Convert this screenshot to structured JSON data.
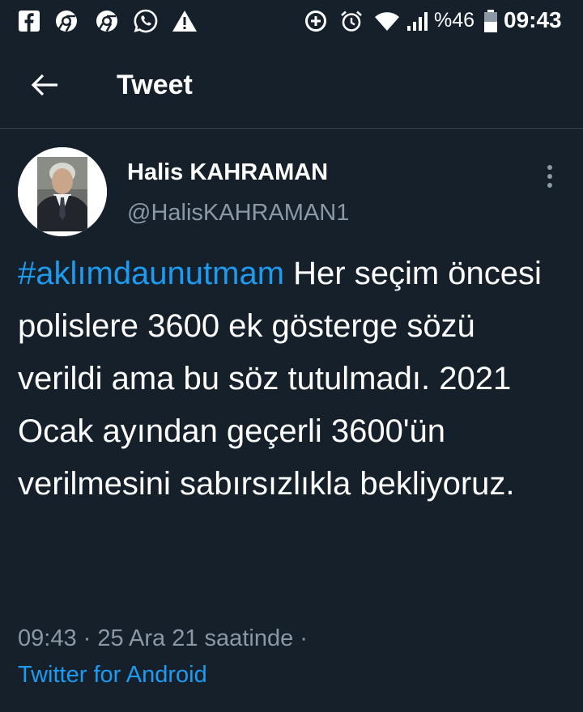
{
  "status_bar": {
    "left_icons": [
      "facebook-icon",
      "chrome-icon",
      "chrome-icon",
      "whatsapp-icon",
      "warning-icon"
    ],
    "right_icons": [
      "data-saver-icon",
      "alarm-icon",
      "wifi-icon",
      "signal-icon",
      "battery-icon"
    ],
    "battery_percent": "%46",
    "time": "09:43"
  },
  "header": {
    "title": "Tweet",
    "back_icon": "arrow-left-icon"
  },
  "tweet": {
    "author_name": "Halis KAHRAMAN",
    "author_handle": "@HalisKAHRAMAN1",
    "hashtag": "#aklımdaunutmam",
    "text": " Her seçim öncesi polislere 3600 ek gösterge sözü verildi ama bu söz tutulmadı. 2021 Ocak ayından geçerli 3600'ün verilmesini sabırsızlıkla bekliyoruz.",
    "meta": "09:43 · 25 Ara 21 saatinde ·",
    "source": "Twitter for Android"
  },
  "colors": {
    "background": "#15202b",
    "accent": "#1d9bf0",
    "secondary_text": "#8b98a5",
    "divider": "#38444d"
  }
}
